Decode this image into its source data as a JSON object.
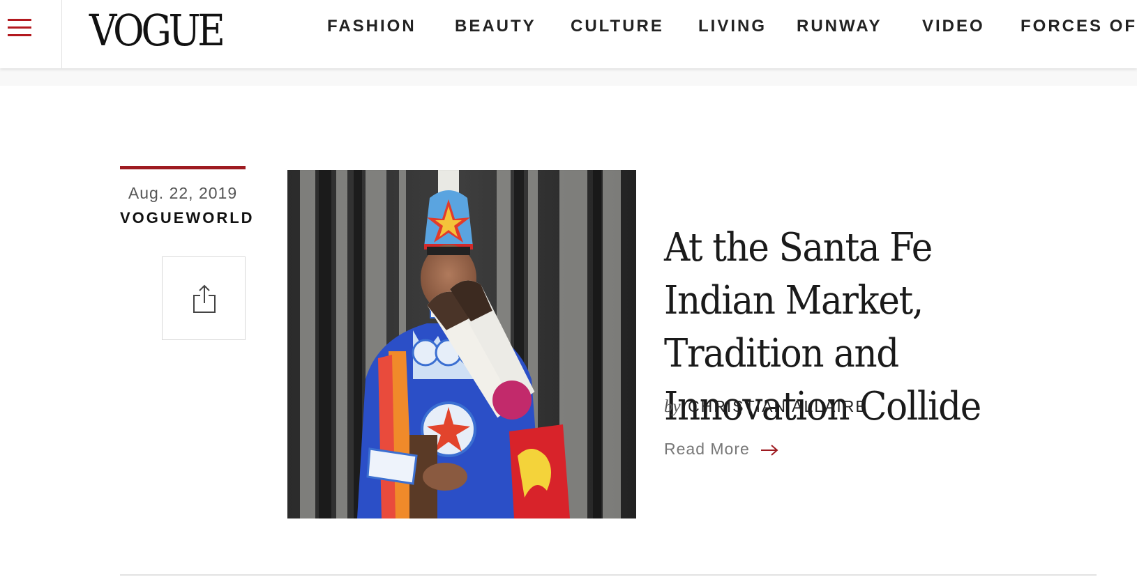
{
  "brand": {
    "logo_text": "VOGUE",
    "accent_color": "#9e1b21"
  },
  "nav": {
    "items": [
      {
        "label": "FASHION"
      },
      {
        "label": "BEAUTY"
      },
      {
        "label": "CULTURE"
      },
      {
        "label": "LIVING"
      },
      {
        "label": "RUNWAY"
      },
      {
        "label": "VIDEO"
      },
      {
        "label": "FORCES OF"
      }
    ]
  },
  "article": {
    "date": "Aug. 22, 2019",
    "category": "VOGUEWORLD",
    "headline": "At the Santa Fe Indian Market, Tradition and Innovation Collide",
    "byline_prefix": "by",
    "author": "CHRISTIAN ALLAIRE",
    "read_more_label": "Read More",
    "image_subject": "woman in blue regalia with beaded crown holding feather fan"
  },
  "icons": {
    "menu": "hamburger-menu-icon",
    "share": "share-icon",
    "read_more": "arrow-right-icon"
  }
}
